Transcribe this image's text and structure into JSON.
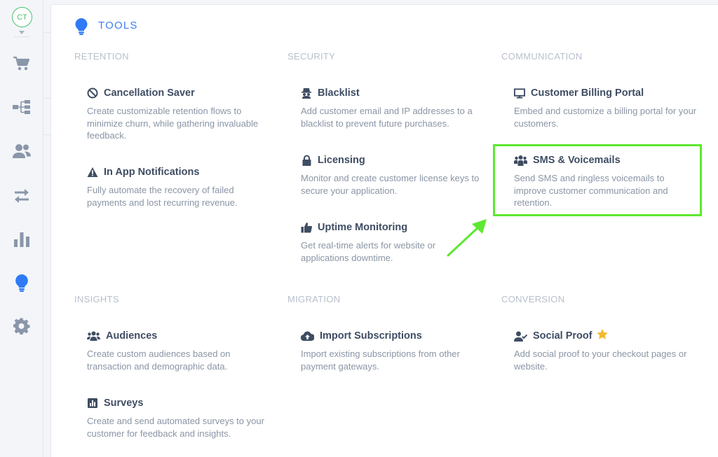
{
  "user": {
    "initials": "CT"
  },
  "sidebar": {
    "items": [
      {
        "icon": "cart-icon"
      },
      {
        "icon": "flow-icon"
      },
      {
        "icon": "users-icon"
      },
      {
        "icon": "exchange-icon"
      },
      {
        "icon": "bar-chart-icon"
      },
      {
        "icon": "lightbulb-icon",
        "active": true
      },
      {
        "icon": "gear-icon"
      }
    ]
  },
  "page": {
    "title": "TOOLS"
  },
  "sections": {
    "retention": "RETENTION",
    "security": "SECURITY",
    "communication": "COMMUNICATION",
    "insights": "INSIGHTS",
    "migration": "MIGRATION",
    "conversion": "CONVERSION"
  },
  "tools": {
    "cancellation_saver": {
      "name": "Cancellation Saver",
      "desc": "Create customizable retention flows to minimize churn, while gathering invaluable feedback."
    },
    "in_app_notifications": {
      "name": "In App Notifications",
      "desc": "Fully automate the recovery of failed payments and lost recurring revenue."
    },
    "blacklist": {
      "name": "Blacklist",
      "desc": "Add customer email and IP addresses to a blacklist to prevent future purchases."
    },
    "licensing": {
      "name": "Licensing",
      "desc": "Monitor and create customer license keys to secure your application."
    },
    "uptime_monitoring": {
      "name": "Uptime Monitoring",
      "desc": "Get real-time alerts for website or applications downtime."
    },
    "customer_billing_portal": {
      "name": "Customer Billing Portal",
      "desc": "Embed and customize a billing portal for your customers."
    },
    "sms_voicemails": {
      "name": "SMS & Voicemails",
      "desc": "Send SMS and ringless voicemails to improve customer communication and retention."
    },
    "audiences": {
      "name": "Audiences",
      "desc": "Create custom audiences based on transaction and demographic data."
    },
    "surveys": {
      "name": "Surveys",
      "desc": "Create and send automated surveys to your customer for feedback and insights."
    },
    "import_subscriptions": {
      "name": "Import Subscriptions",
      "desc": "Import existing subscriptions from other payment gateways."
    },
    "social_proof": {
      "name": "Social Proof",
      "desc": "Add social proof to your checkout pages or website."
    }
  },
  "colors": {
    "accent": "#3d7ff2",
    "highlight": "#5ee831",
    "star": "#f5b82e",
    "icon_gray": "#8a96aa"
  }
}
